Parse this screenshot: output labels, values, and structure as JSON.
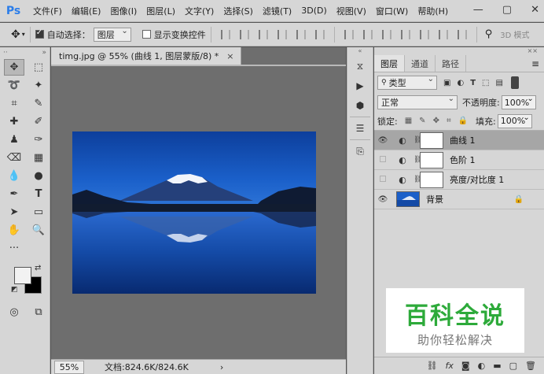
{
  "app": {
    "logo": "Ps"
  },
  "menu": [
    "文件(F)",
    "编辑(E)",
    "图像(I)",
    "图层(L)",
    "文字(Y)",
    "选择(S)",
    "滤镜(T)",
    "3D(D)",
    "视图(V)",
    "窗口(W)",
    "帮助(H)"
  ],
  "window_controls": {
    "minimize": "—",
    "maximize": "▢",
    "close": "✕"
  },
  "options": {
    "auto_select_label": "自动选择：",
    "auto_select_checked": true,
    "auto_select_target": "图层",
    "show_transform_label": "显示变换控件",
    "show_transform_checked": false,
    "mode_3d": "3D 模式"
  },
  "document": {
    "tab_title": "timg.jpg @ 55% (曲线 1, 图层蒙版/8) *",
    "close": "×",
    "zoom": "55%",
    "doc_info": "文档:824.6K/824.6K",
    "status_arrow": "›"
  },
  "panel": {
    "tabs": [
      "图层",
      "通道",
      "路径"
    ],
    "active_tab": "图层",
    "menu_icon": "≡",
    "filter_kind": "类型",
    "blend_mode": "正常",
    "opacity_label": "不透明度:",
    "opacity_value": "100%",
    "lock_label": "锁定:",
    "fill_label": "填充:",
    "fill_value": "100%"
  },
  "layers": [
    {
      "name": "曲线 1",
      "visible": true,
      "type": "adjustment",
      "selected": true
    },
    {
      "name": "色阶 1",
      "visible": false,
      "type": "adjustment",
      "selected": false
    },
    {
      "name": "亮度/对比度 1",
      "visible": false,
      "type": "adjustment",
      "selected": false
    },
    {
      "name": "背景",
      "visible": true,
      "type": "background",
      "selected": false,
      "locked": true
    }
  ],
  "footer_icons": [
    "link-icon",
    "fx-icon",
    "mask-icon",
    "adjustment-icon",
    "group-icon",
    "new-layer-icon",
    "trash-icon"
  ],
  "watermark": {
    "title": "百科全说",
    "subtitle": "助你轻松解决"
  },
  "colors": {
    "accent": "#2b7de9",
    "watermark_green": "#2daa3a",
    "foreground": "#f2f2f2",
    "background": "#000000"
  }
}
